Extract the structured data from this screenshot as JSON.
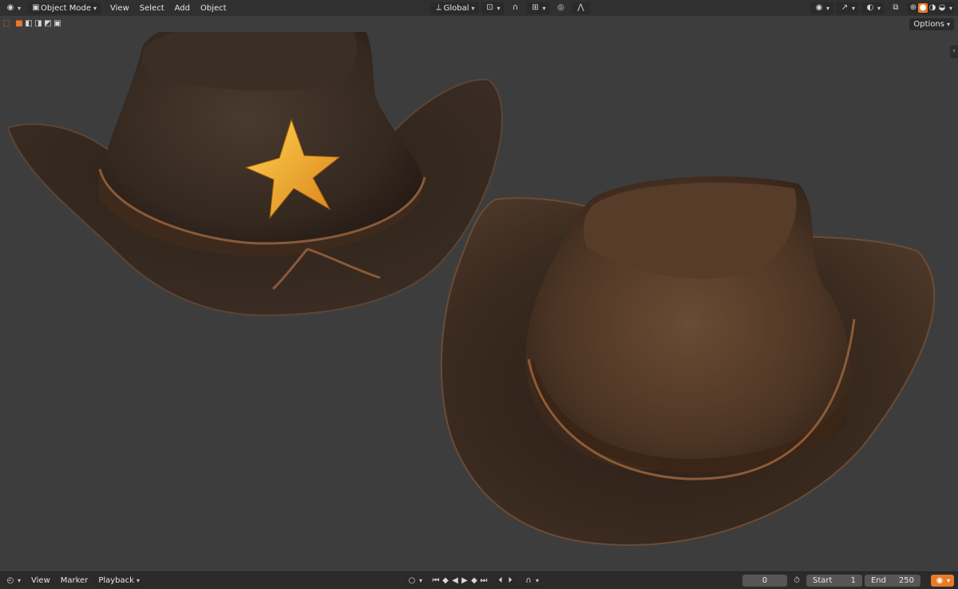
{
  "header": {
    "mode_label": "Object Mode",
    "menu": [
      "View",
      "Select",
      "Add",
      "Object"
    ],
    "transform_orientation": "Global",
    "options_label": "Options"
  },
  "timeline": {
    "menu": [
      "View",
      "Marker",
      "Playback"
    ],
    "current_frame": "0",
    "start_label": "Start",
    "start_value": "1",
    "end_label": "End",
    "end_value": "250"
  },
  "colors": {
    "accent": "#e97b27",
    "viewport_bg": "#3d3d3d",
    "header_bg": "#303030",
    "hat_brown": "#3a2b20",
    "star_gold": "#f2a623"
  }
}
